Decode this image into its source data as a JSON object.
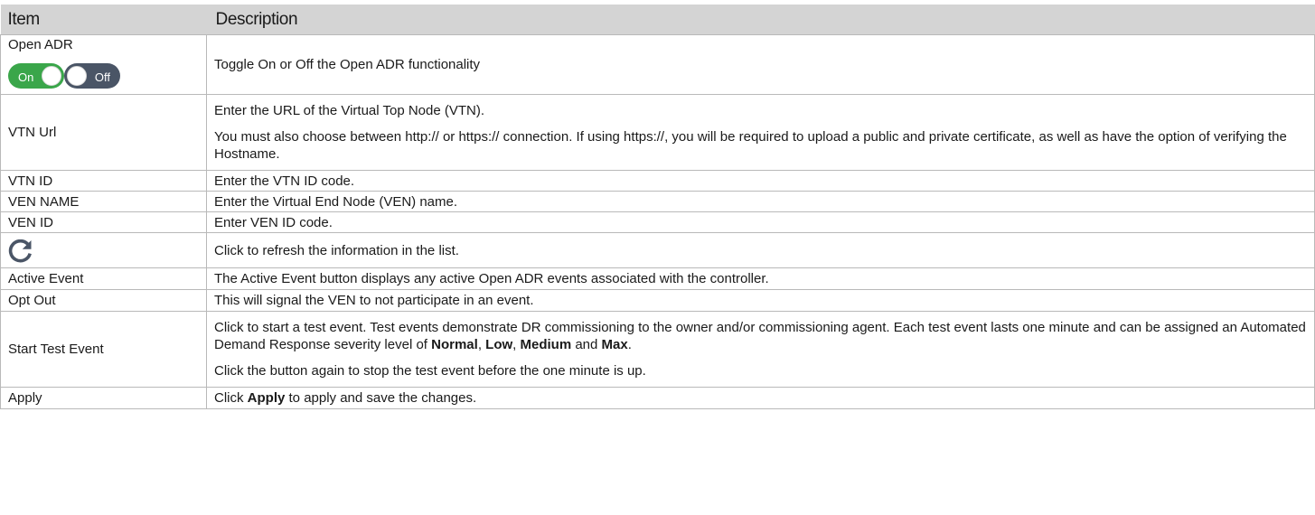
{
  "header": {
    "item": "Item",
    "description": "Description"
  },
  "rows": {
    "open_adr": {
      "item": "Open ADR",
      "toggle_on_label": "On",
      "toggle_off_label": "Off",
      "description": "Toggle On or Off the Open ADR functionality"
    },
    "vtn_url": {
      "item": "VTN Url",
      "description_1": "Enter the URL of the Virtual Top Node (VTN).",
      "description_2": "You must also choose between http:// or https:// connection. If using https://, you will be required to upload a public and private certificate, as well as have the option of verifying the Hostname."
    },
    "vtn_id": {
      "item": "VTN ID",
      "description": "Enter the VTN ID code."
    },
    "ven_name": {
      "item": "VEN NAME",
      "description": "Enter the Virtual End Node (VEN) name."
    },
    "ven_id": {
      "item": "VEN ID",
      "description": "Enter VEN ID code."
    },
    "refresh": {
      "icon": "refresh-icon",
      "description": "Click to refresh the information in the list."
    },
    "active_event": {
      "item": "Active Event",
      "description": "The Active Event button displays any active Open ADR events associated with the controller."
    },
    "opt_out": {
      "item": "Opt Out",
      "description": "This will signal the VEN to not participate in an event."
    },
    "start_test_event": {
      "item": "Start Test Event",
      "description_1_pre": "Click to start a test event. Test events demonstrate DR commissioning to the owner and/or commissioning agent. Each test event lasts one minute and can be assigned an Automated Demand Response severity level of ",
      "level_normal": "Normal",
      "sep_1": ", ",
      "level_low": "Low",
      "sep_2": ", ",
      "level_medium": "Medium",
      "sep_3": " and ",
      "level_max": "Max",
      "end": ".",
      "description_2": "Click the button again to stop the test event before the one minute is up."
    },
    "apply": {
      "item": "Apply",
      "description_pre": "Click ",
      "apply_word": "Apply",
      "description_post": " to apply and save the changes."
    }
  },
  "colors": {
    "header_bg": "#d4d4d4",
    "toggle_on": "#3aa64a",
    "toggle_off": "#4a5566",
    "border": "#b9b9b9",
    "icon": "#4a5566"
  }
}
